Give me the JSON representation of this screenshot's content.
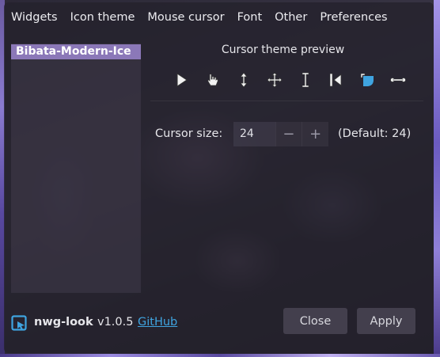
{
  "menu": [
    "Widgets",
    "Icon theme",
    "Mouse cursor",
    "Font",
    "Other",
    "Preferences"
  ],
  "themes": {
    "selected": "Bibata-Modern-Ice"
  },
  "preview": {
    "title": "Cursor theme preview",
    "cursors": [
      "arrow-pointer-icon",
      "hand-pointer-icon",
      "vertical-resize-icon",
      "move-icon",
      "text-cursor-icon",
      "left-edge-icon",
      "corner-resize-icon",
      "horizontal-resize-icon"
    ]
  },
  "cursor_size": {
    "label": "Cursor size:",
    "value": "24",
    "minus": "−",
    "plus": "+",
    "default_text": "(Default: 24)"
  },
  "footer": {
    "app_name": "nwg-look",
    "version": "v1.0.5",
    "link": "GitHub"
  },
  "buttons": {
    "close": "Close",
    "apply": "Apply"
  },
  "colors": {
    "selection": "#8b78b8",
    "link": "#3fa4e0",
    "accent_icon": "#3fa4e0"
  }
}
